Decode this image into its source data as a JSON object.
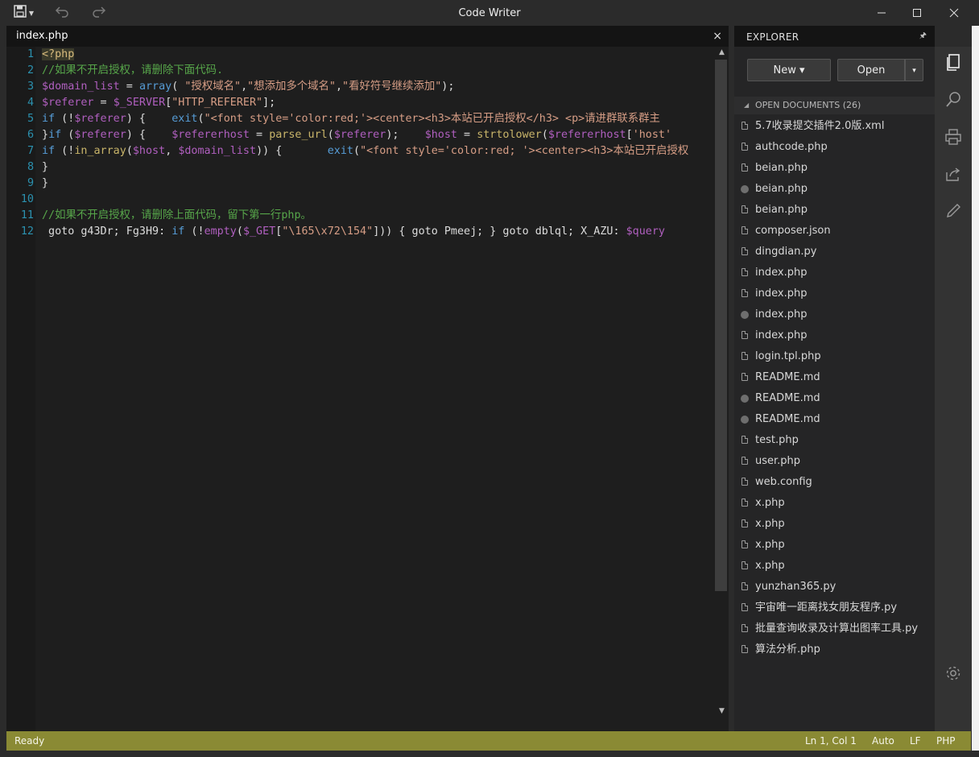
{
  "window": {
    "title": "Code Writer"
  },
  "editor": {
    "tab_label": "index.php",
    "close_glyph": "×",
    "line_numbers": [
      "1",
      "2",
      "3",
      "4",
      "5",
      "6",
      "7",
      "8",
      "9",
      "10",
      "11",
      "12"
    ],
    "lines": [
      [
        {
          "t": "<?php",
          "c": "tag"
        }
      ],
      [
        {
          "t": "//如果不开启授权，请删除下面代码.",
          "c": "com"
        }
      ],
      [
        {
          "t": "$domain_list",
          "c": "var"
        },
        {
          "t": " = ",
          "c": "pl"
        },
        {
          "t": "array",
          "c": "kw"
        },
        {
          "t": "( ",
          "c": "pl"
        },
        {
          "t": "\"授权域名\"",
          "c": "str"
        },
        {
          "t": ",",
          "c": "pl"
        },
        {
          "t": "\"想添加多个域名\"",
          "c": "str"
        },
        {
          "t": ",",
          "c": "pl"
        },
        {
          "t": "\"看好符号继续添加\"",
          "c": "str"
        },
        {
          "t": ");",
          "c": "pl"
        }
      ],
      [
        {
          "t": "$referer",
          "c": "var"
        },
        {
          "t": " = ",
          "c": "pl"
        },
        {
          "t": "$_SERVER",
          "c": "var"
        },
        {
          "t": "[",
          "c": "pl"
        },
        {
          "t": "\"HTTP_REFERER\"",
          "c": "str"
        },
        {
          "t": "];",
          "c": "pl"
        }
      ],
      [
        {
          "t": "if",
          "c": "kw"
        },
        {
          "t": " (!",
          "c": "pl"
        },
        {
          "t": "$referer",
          "c": "var"
        },
        {
          "t": ") {    ",
          "c": "pl"
        },
        {
          "t": "exit",
          "c": "kw"
        },
        {
          "t": "(",
          "c": "pl"
        },
        {
          "t": "\"<font style='color:red;'><center><h3>本站已开启授权</h3> <p>请进群联系群主",
          "c": "str"
        }
      ],
      [
        {
          "t": "}",
          "c": "pl"
        },
        {
          "t": "if",
          "c": "kw"
        },
        {
          "t": " (",
          "c": "pl"
        },
        {
          "t": "$referer",
          "c": "var"
        },
        {
          "t": ") {    ",
          "c": "pl"
        },
        {
          "t": "$refererhost",
          "c": "var"
        },
        {
          "t": " = ",
          "c": "pl"
        },
        {
          "t": "parse_url",
          "c": "fn"
        },
        {
          "t": "(",
          "c": "pl"
        },
        {
          "t": "$referer",
          "c": "var"
        },
        {
          "t": ");    ",
          "c": "pl"
        },
        {
          "t": "$host",
          "c": "var"
        },
        {
          "t": " = ",
          "c": "pl"
        },
        {
          "t": "strtolower",
          "c": "fn"
        },
        {
          "t": "(",
          "c": "pl"
        },
        {
          "t": "$refererhost",
          "c": "var"
        },
        {
          "t": "[",
          "c": "pl"
        },
        {
          "t": "'host'",
          "c": "str"
        }
      ],
      [
        {
          "t": "if",
          "c": "kw"
        },
        {
          "t": " (!",
          "c": "pl"
        },
        {
          "t": "in_array",
          "c": "fn"
        },
        {
          "t": "(",
          "c": "pl"
        },
        {
          "t": "$host",
          "c": "var"
        },
        {
          "t": ", ",
          "c": "pl"
        },
        {
          "t": "$domain_list",
          "c": "var"
        },
        {
          "t": ")) {       ",
          "c": "pl"
        },
        {
          "t": "exit",
          "c": "kw"
        },
        {
          "t": "(",
          "c": "pl"
        },
        {
          "t": "\"<font style='color:red; '><center><h3>本站已开启授权",
          "c": "str"
        }
      ],
      [
        {
          "t": "}",
          "c": "pl"
        }
      ],
      [
        {
          "t": "}",
          "c": "pl"
        }
      ],
      [],
      [
        {
          "t": "//如果不开启授权，请删除上面代码，留下第一行php。",
          "c": "com"
        }
      ],
      [
        {
          "t": " goto g43Dr; Fg3H9: ",
          "c": "pl"
        },
        {
          "t": "if",
          "c": "kw"
        },
        {
          "t": " (!",
          "c": "pl"
        },
        {
          "t": "empty",
          "c": "var"
        },
        {
          "t": "(",
          "c": "pl"
        },
        {
          "t": "$_GET",
          "c": "var"
        },
        {
          "t": "[",
          "c": "pl"
        },
        {
          "t": "\"\\165\\x72\\154\"",
          "c": "str"
        },
        {
          "t": "])) { goto Pmeej; } goto dblql; X_AZU: ",
          "c": "pl"
        },
        {
          "t": "$query",
          "c": "var"
        }
      ]
    ]
  },
  "explorer": {
    "title": "EXPLORER",
    "pin_glyph": "🖈",
    "new_label": "New ▾",
    "open_label": "Open",
    "open_dropdown_glyph": "▾",
    "open_documents_label": "OPEN DOCUMENTS (26)",
    "files": [
      {
        "name": "5.7收录提交插件2.0版.xml",
        "modified": false
      },
      {
        "name": "authcode.php",
        "modified": false
      },
      {
        "name": "beian.php",
        "modified": false
      },
      {
        "name": "beian.php",
        "modified": true
      },
      {
        "name": "beian.php",
        "modified": false
      },
      {
        "name": "composer.json",
        "modified": false
      },
      {
        "name": "dingdian.py",
        "modified": false
      },
      {
        "name": "index.php",
        "modified": false
      },
      {
        "name": "index.php",
        "modified": false
      },
      {
        "name": "index.php",
        "modified": true
      },
      {
        "name": "index.php",
        "modified": false
      },
      {
        "name": "login.tpl.php",
        "modified": false
      },
      {
        "name": "README.md",
        "modified": false
      },
      {
        "name": "README.md",
        "modified": true
      },
      {
        "name": "README.md",
        "modified": true
      },
      {
        "name": "test.php",
        "modified": false
      },
      {
        "name": "user.php",
        "modified": false
      },
      {
        "name": "web.config",
        "modified": false
      },
      {
        "name": "x.php",
        "modified": false
      },
      {
        "name": "x.php",
        "modified": false
      },
      {
        "name": "x.php",
        "modified": false
      },
      {
        "name": "x.php",
        "modified": false
      },
      {
        "name": "yunzhan365.py",
        "modified": false
      },
      {
        "name": "宇宙唯一距离找女朋友程序.py",
        "modified": false
      },
      {
        "name": "批量查询收录及计算出图率工具.py",
        "modified": false
      },
      {
        "name": "算法分析.php",
        "modified": false
      }
    ]
  },
  "status": {
    "ready": "Ready",
    "position": "Ln 1, Col 1",
    "encoding": "Auto",
    "line_ending": "LF",
    "language": "PHP"
  },
  "colors": {
    "tag": "#d7ba7d",
    "com": "#57a64a",
    "var": "#b05fbf",
    "str": "#d69d85",
    "kw": "#569cd6",
    "fn": "#c9b56a",
    "pl": "#dcdcdc",
    "status_bar": "#8a8a34"
  }
}
